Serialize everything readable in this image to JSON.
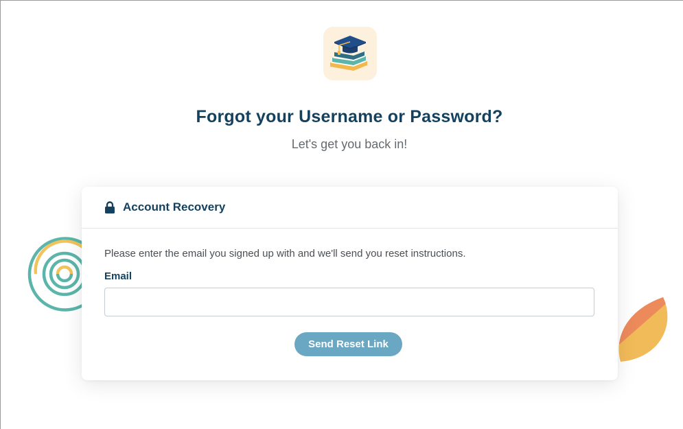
{
  "header": {
    "logo_icon": "graduation-cap-books-icon",
    "title": "Forgot your Username or Password?",
    "subtitle": "Let's get you back in!"
  },
  "card": {
    "header_icon": "lock-icon",
    "header_title": "Account Recovery",
    "instructions": "Please enter the email you signed up with and we'll send you reset instructions.",
    "email_label": "Email",
    "email_value": "",
    "email_placeholder": "",
    "submit_label": "Send Reset Link"
  },
  "colors": {
    "primary_text": "#14425e",
    "button": "#6aa7c2",
    "logo_bg": "#fdf0dc",
    "ring_teal": "#5bb5aa",
    "ring_yellow": "#f0c35c",
    "leaf_orange": "#ec8a5c",
    "leaf_yellow": "#f2bb59"
  }
}
